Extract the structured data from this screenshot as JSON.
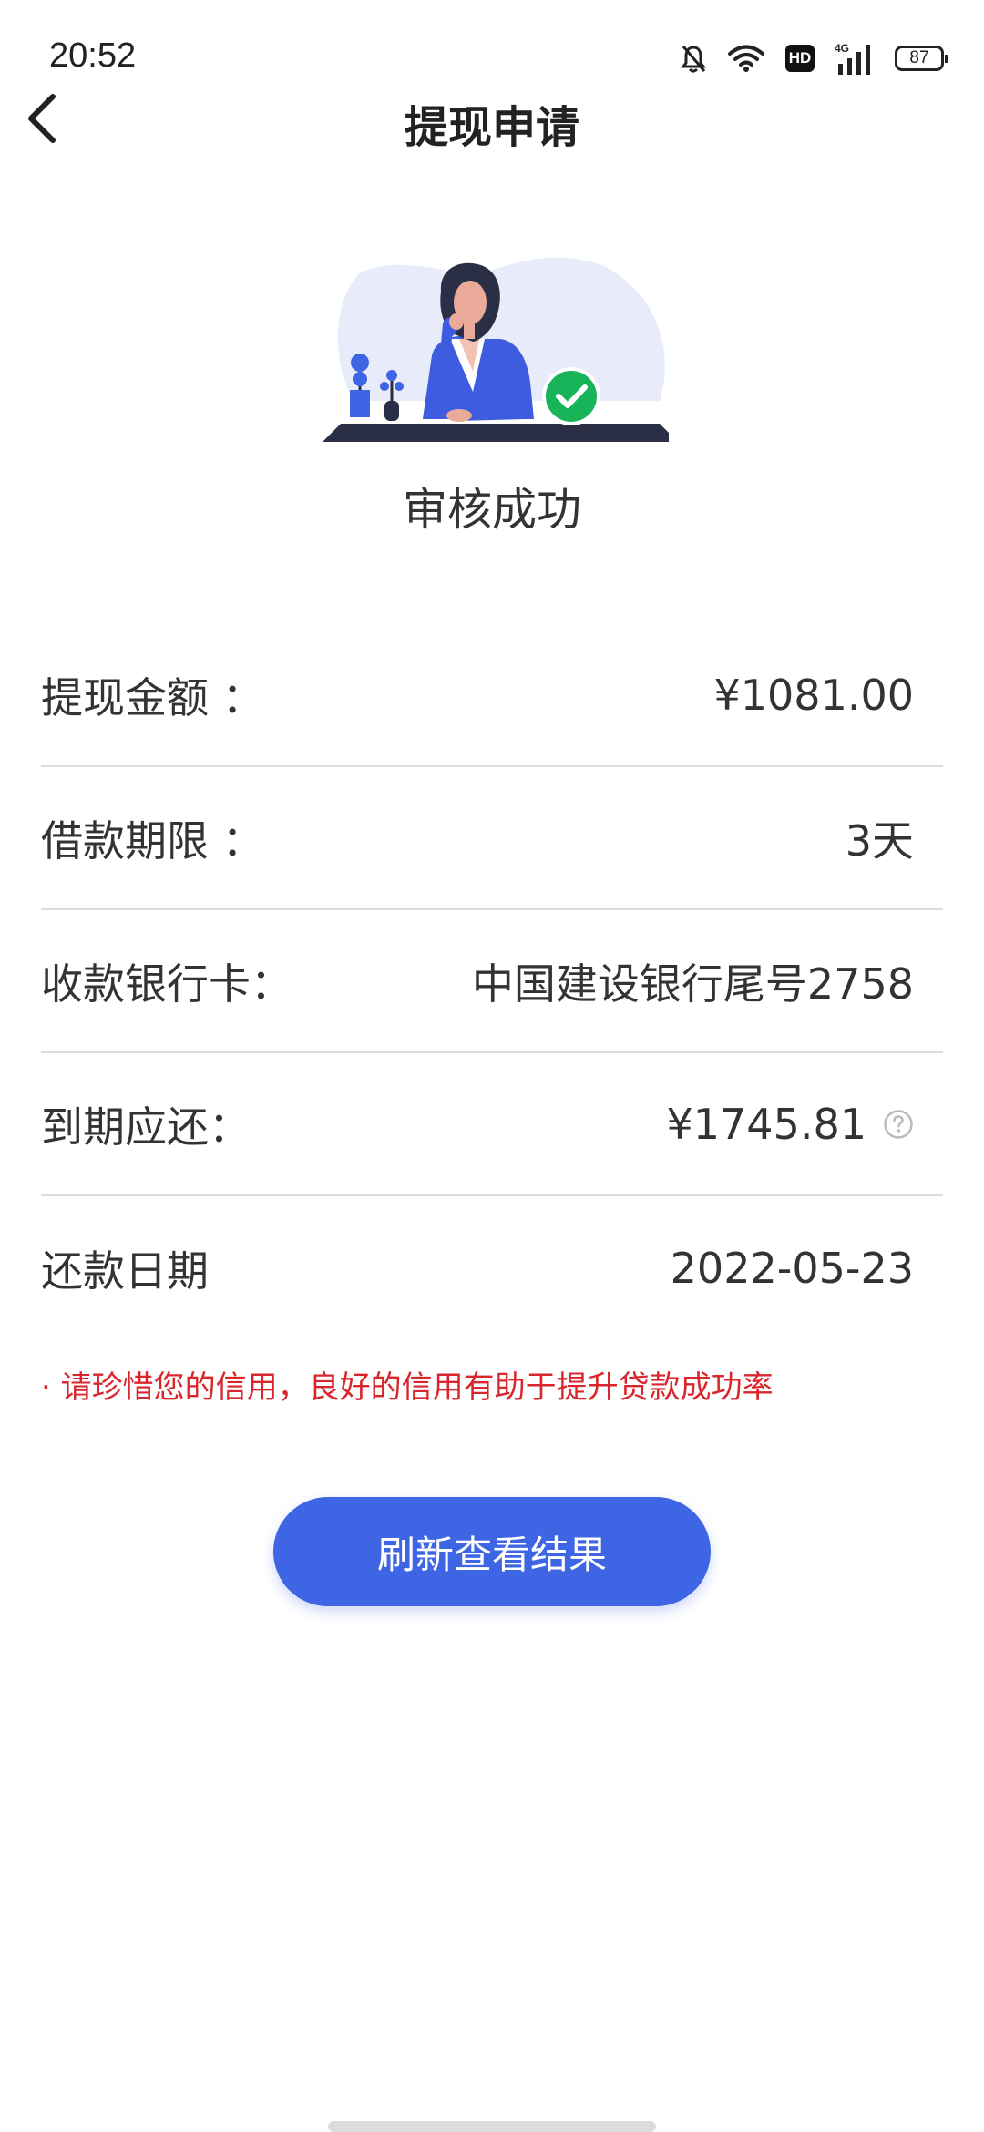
{
  "status_bar": {
    "time": "20:52",
    "battery": "87",
    "icons": [
      "bell-off-icon",
      "wifi-icon",
      "hd-icon",
      "signal-4g-icon",
      "battery-icon"
    ],
    "hd_label": "HD",
    "network_label": "4G"
  },
  "header": {
    "title": "提现申请",
    "back_icon": "chevron-left-icon"
  },
  "result": {
    "status": "审核成功",
    "badge_icon": "check-icon",
    "badge_color": "#19b35a"
  },
  "info": [
    {
      "label": "提现金额 ：",
      "value": "¥1081.00"
    },
    {
      "label": "借款期限 ：",
      "value": "3天"
    },
    {
      "label": "收款银行卡：",
      "value": "中国建设银行尾号2758"
    },
    {
      "label": "到期应还：",
      "value": "¥1745.81",
      "icon": "help-circle-icon"
    },
    {
      "label": "还款日期",
      "value": "2022-05-23"
    }
  ],
  "notice": "· 请珍惜您的信用，良好的信用有助于提升贷款成功率",
  "button": {
    "label": "刷新查看结果",
    "color": "#3d65e4"
  }
}
